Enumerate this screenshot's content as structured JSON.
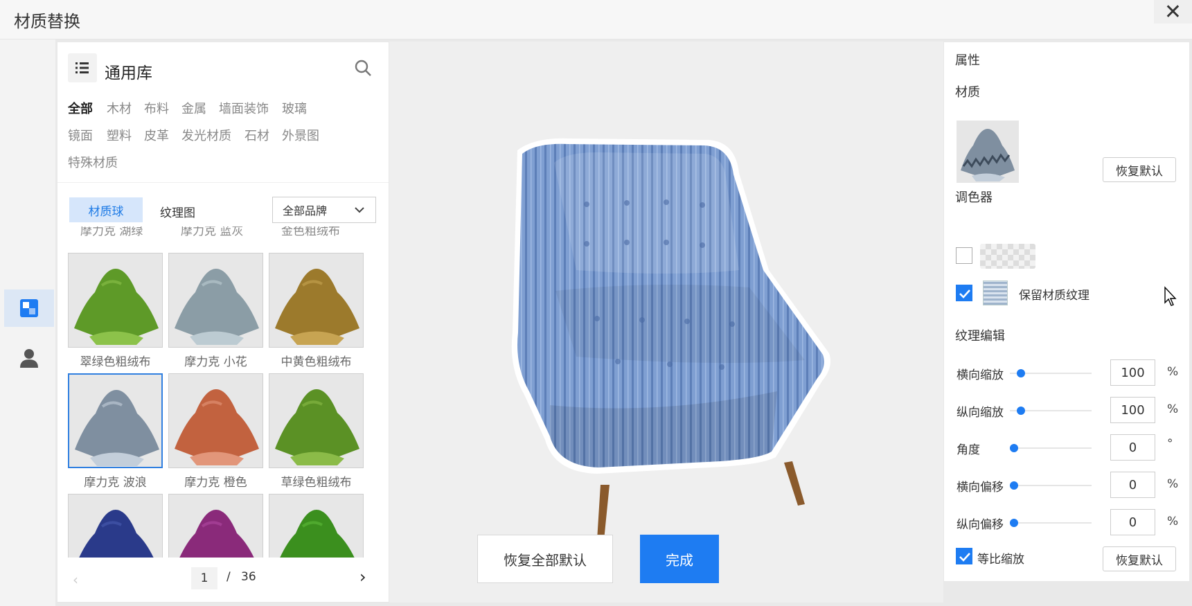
{
  "window": {
    "title": "材质替换"
  },
  "library": {
    "title": "通用库",
    "categories": [
      "全部",
      "木材",
      "布料",
      "金属",
      "墙面装饰",
      "玻璃",
      "镜面",
      "塑料",
      "皮革",
      "发光材质",
      "石材",
      "外景图",
      "特殊材质"
    ],
    "active_category": "全部",
    "tabs": {
      "balls": "材质球",
      "texture": "纹理图"
    },
    "brand_filter": "全部品牌",
    "prev_row_labels": [
      "摩力克 湖绿",
      "摩力克 蓝灰",
      "金色粗绒布"
    ],
    "tiles": [
      {
        "label": "翠绿色粗绒布",
        "color": "#5e9a28",
        "light": "#8cc24a"
      },
      {
        "label": "摩力克 小花",
        "color": "#8b9da6",
        "light": "#bccbd2"
      },
      {
        "label": "中黄色粗绒布",
        "color": "#9c7a2c",
        "light": "#c7a452"
      },
      {
        "label": "摩力克 波浪",
        "color": "#7f8fa0",
        "light": "#c3ceda"
      },
      {
        "label": "摩力克 橙色",
        "color": "#c2623f",
        "light": "#e2967a"
      },
      {
        "label": "草绿色粗绒布",
        "color": "#5b9125",
        "light": "#8bbb48"
      },
      {
        "label": "",
        "color": "#2a3a8a",
        "light": "#4a5cb0"
      },
      {
        "label": "",
        "color": "#8a2a7a",
        "light": "#b04aa2"
      },
      {
        "label": "",
        "color": "#3b8f1e",
        "light": "#5dbb38"
      }
    ],
    "pagination": {
      "current": "1",
      "separator": "/",
      "total": "36"
    }
  },
  "viewport": {
    "reset_all_label": "恢复全部默认",
    "done_label": "完成"
  },
  "properties": {
    "title": "属性",
    "material_heading": "材质",
    "reset_label": "恢复默认",
    "palette_heading": "调色器",
    "keep_texture_label": "保留材质纹理",
    "texture_edit_heading": "纹理编辑",
    "rows": [
      {
        "label": "横向缩放",
        "value": "100",
        "unit": "%"
      },
      {
        "label": "纵向缩放",
        "value": "100",
        "unit": "%"
      },
      {
        "label": "角度",
        "value": "0",
        "unit": "°"
      },
      {
        "label": "横向偏移",
        "value": "0",
        "unit": "%"
      },
      {
        "label": "纵向偏移",
        "value": "0",
        "unit": "%"
      }
    ],
    "proportional_label": "等比缩放",
    "reset_label_2": "恢复默认"
  },
  "colors": {
    "accent": "#1e7cf2",
    "sofa": "#7f9fd2"
  }
}
